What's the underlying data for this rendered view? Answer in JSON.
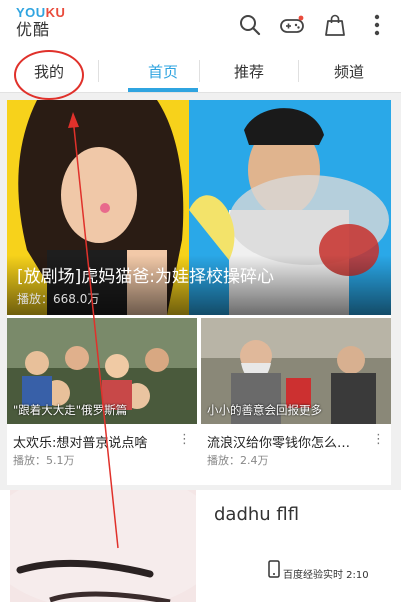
{
  "app": {
    "logo_en_1": "YOU",
    "logo_en_2": "KU",
    "logo_cn": "优酷",
    "brand_color": "#2fa4e0"
  },
  "topbar": {
    "icons": [
      "search-icon",
      "gamepad-icon",
      "shopping-bag-icon",
      "more-vertical-icon"
    ]
  },
  "tabs": [
    {
      "label": "我的",
      "active": false
    },
    {
      "label": "首页",
      "active": true
    },
    {
      "label": "推荐",
      "active": false
    },
    {
      "label": "频道",
      "active": false
    }
  ],
  "hero": {
    "title": "[放剧场]虎妈猫爸:为娃择校操碎心",
    "plays": "播放：668.0万"
  },
  "cards": [
    {
      "caption": "\"跟着大大走\"俄罗斯篇",
      "title": "太欢乐:想对普京说点啥",
      "plays": "播放：5.1万"
    },
    {
      "caption": "小小的善意会回报更多",
      "title": "流浪汉给你零钱你怎么…",
      "plays": "播放：2.4万"
    }
  ],
  "bottom": {
    "title": "dadhu flfl",
    "note": "百度经验实时 2:10"
  },
  "colors": {
    "annotation_red": "#e0312b",
    "hero_left_bg": "#f7d21b",
    "hero_right_bg": "#2aa8e8"
  }
}
